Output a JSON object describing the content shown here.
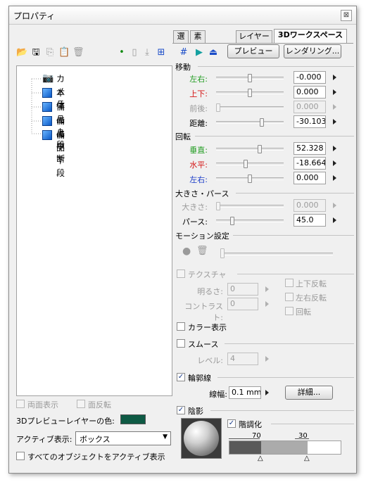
{
  "window": {
    "title": "プロパティ",
    "close_glyph": "⊠"
  },
  "tabs": [
    "選",
    "素",
    "レイヤー",
    "3Dワークスペース"
  ],
  "toolbar": {
    "preview_label": "プレビュー",
    "rendering_label": "レンダリング..."
  },
  "tree": {
    "items": [
      "カメラ",
      "本体",
      "備品上段",
      "備品中断",
      "備品下段"
    ]
  },
  "movement": {
    "title": "移動",
    "rows": [
      {
        "label": "左右:",
        "value": "-0.000",
        "color": "#1f9b1f",
        "enabled": true
      },
      {
        "label": "上下:",
        "value": "0.000",
        "color": "#d41414",
        "enabled": true
      },
      {
        "label": "前後:",
        "value": "0.000",
        "color": "#9a9a9a",
        "enabled": false
      },
      {
        "label": "距離:",
        "value": "-30.103",
        "color": "#000000",
        "enabled": true
      }
    ]
  },
  "rotation": {
    "title": "回転",
    "rows": [
      {
        "label": "垂直:",
        "value": "52.328",
        "color": "#1f9b1f"
      },
      {
        "label": "水平:",
        "value": "-18.664",
        "color": "#d41414"
      },
      {
        "label": "左右:",
        "value": "0.000",
        "color": "#1a3cc8"
      }
    ]
  },
  "size_perspective": {
    "title": "大きさ・パース",
    "size_label": "大きさ:",
    "size_value": "0.000",
    "perspective_label": "パース:",
    "perspective_value": "45.0"
  },
  "motion": {
    "title": "モーション設定"
  },
  "texture": {
    "title": "テクスチャ",
    "brightness_label": "明るさ:",
    "brightness_value": "0",
    "contrast_label": "コントラスト:",
    "contrast_value": "0",
    "flip_v": "上下反転",
    "flip_h": "左右反転",
    "rotate": "回転"
  },
  "color_display": {
    "label": "カラー表示",
    "checked": false
  },
  "smooth": {
    "label": "スムース",
    "level_label": "レベル:",
    "level_value": "4"
  },
  "outline": {
    "label": "輪郭線",
    "checked": true,
    "width_label": "線幅:",
    "width_value": "0.1 mm",
    "detail_label": "詳細..."
  },
  "shadow": {
    "label": "陰影",
    "checked": true,
    "gradation_label": "階調化",
    "gradation_checked": true,
    "mark1": "70",
    "mark2": "30"
  },
  "bottom_left": {
    "double_side": "両面表示",
    "flip_face": "面反転",
    "layer_color_label": "3Dプレビューレイヤーの色:",
    "layer_color": "#0e5a44",
    "active_display_label": "アクティブ表示:",
    "active_display_value": "ボックス",
    "all_objects_active": "すべてのオブジェクトをアクティブ表示"
  },
  "colors": {
    "tree_cube": "#1c7be0",
    "accent": "#1a3c8a"
  }
}
